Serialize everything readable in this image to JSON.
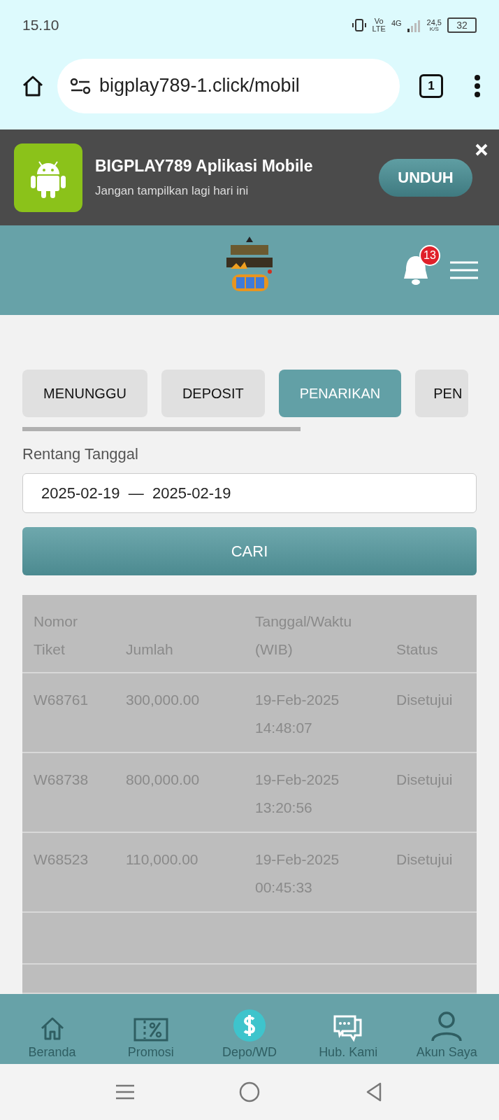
{
  "status_bar": {
    "time": "15.10",
    "volte_top": "Vo",
    "volte_bottom": "LTE",
    "network_type": "4G",
    "net_speed": "24,5",
    "net_unit": "K/S",
    "battery": "32"
  },
  "browser": {
    "url": "bigplay789-1.click/mobil",
    "tab_count": "1"
  },
  "app_banner": {
    "title": "BIGPLAY789 Aplikasi Mobile",
    "subtitle": "Jangan tampilkan lagi hari ini",
    "button": "UNDUH"
  },
  "header": {
    "notification_count": "13"
  },
  "tabs": [
    {
      "label": "MENUNGGU",
      "selected": false
    },
    {
      "label": "DEPOSIT",
      "selected": false
    },
    {
      "label": "PENARIKAN",
      "selected": true
    },
    {
      "label": "PEN",
      "selected": false
    }
  ],
  "date_range": {
    "label": "Rentang Tanggal",
    "value": "2025-02-19  —  2025-02-19"
  },
  "search_button": "CARI",
  "table": {
    "columns": [
      "Nomor\nTiket",
      "Jumlah",
      "Tanggal/Waktu\n(WIB)",
      "Status"
    ],
    "rows": [
      [
        "W68761",
        "300,000.00",
        "19-Feb-2025\n14:48:07",
        "Disetujui"
      ],
      [
        "W68738",
        "800,000.00",
        "19-Feb-2025\n13:20:56",
        "Disetujui"
      ],
      [
        "W68523",
        "110,000.00",
        "19-Feb-2025\n00:45:33",
        "Disetujui"
      ]
    ]
  },
  "bottom_nav": [
    {
      "label": "Beranda",
      "kind": "home",
      "selected": false
    },
    {
      "label": "Promosi",
      "kind": "promo",
      "selected": false
    },
    {
      "label": "Depo/WD",
      "kind": "deposit",
      "selected": true
    },
    {
      "label": "Hub. Kami",
      "kind": "chat",
      "selected": false
    },
    {
      "label": "Akun Saya",
      "kind": "account",
      "selected": false
    }
  ]
}
